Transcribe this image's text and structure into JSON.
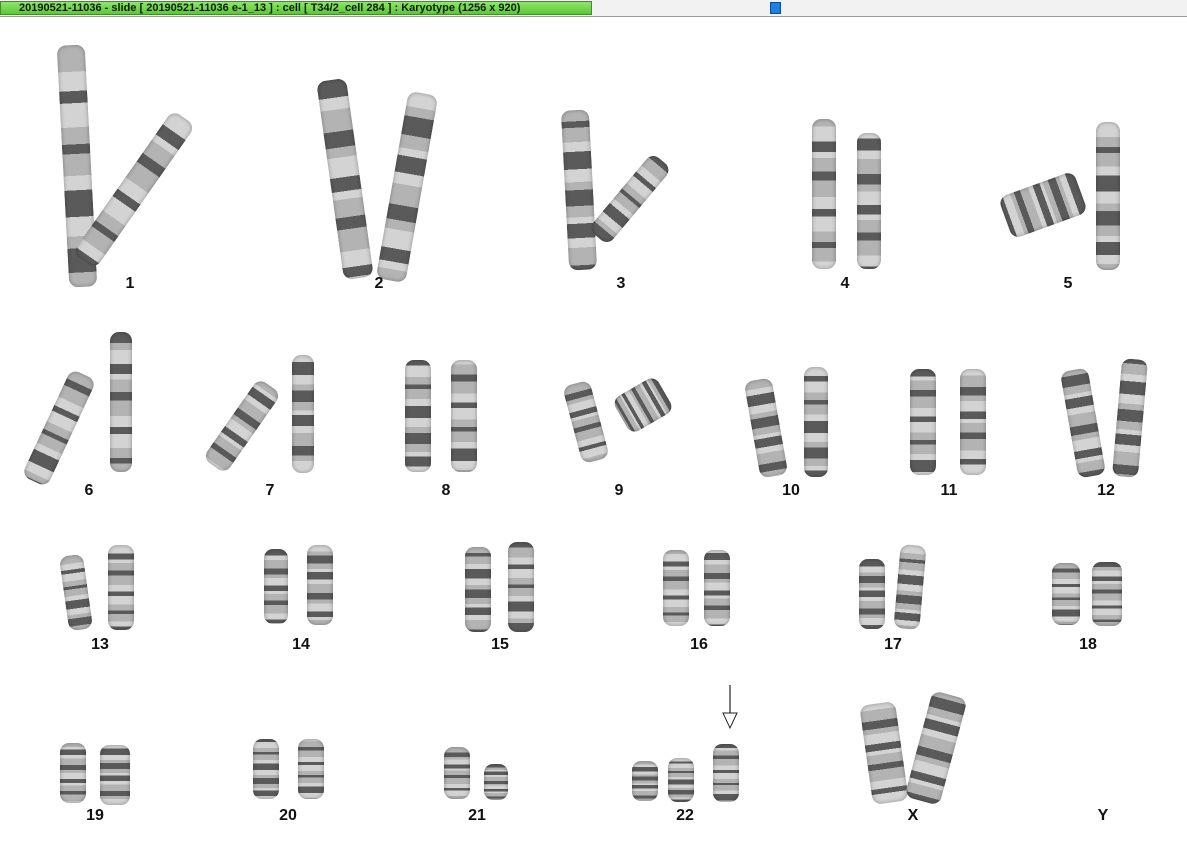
{
  "window": {
    "title": "20190521-11036 - slide [ 20190521-11036 e-1_13 ] : cell [ T34/2_cell 284 ] : Karyotype  (1256 x 920)"
  },
  "karyotype": {
    "labels": [
      "1",
      "2",
      "3",
      "4",
      "5",
      "6",
      "7",
      "8",
      "9",
      "10",
      "11",
      "12",
      "13",
      "14",
      "15",
      "16",
      "17",
      "18",
      "19",
      "20",
      "21",
      "22",
      "X",
      "Y"
    ],
    "marker": "arrow-down-icon",
    "colors": {
      "chromosome_light": "#c8c8c8",
      "chromosome_dark": "#2a2a2a",
      "accent": "#5cc63a",
      "marker": "#1f7fe0"
    }
  }
}
